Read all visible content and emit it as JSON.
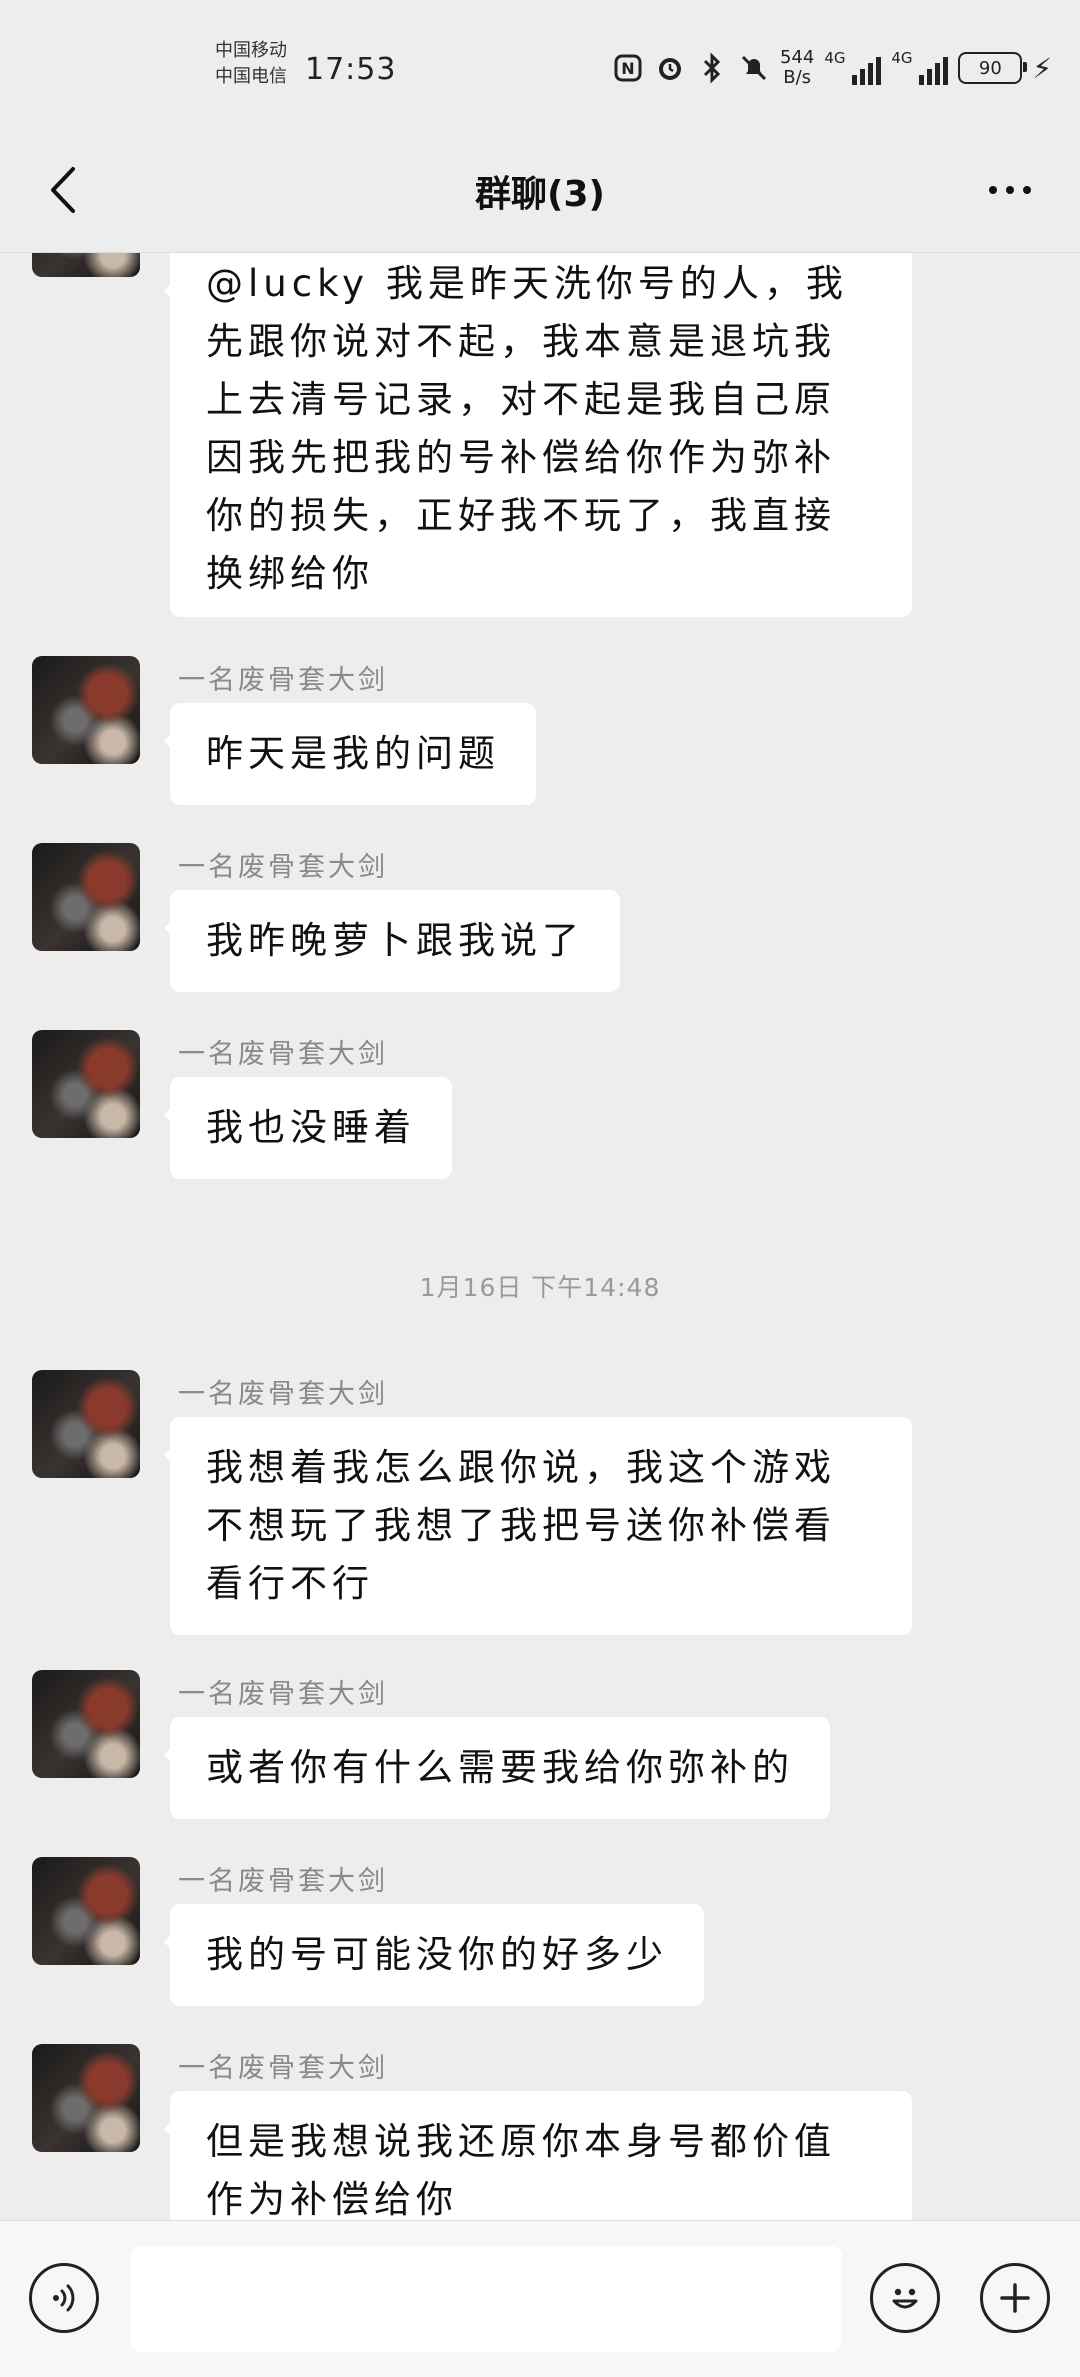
{
  "status_bar": {
    "carrier_1": "中国移动",
    "carrier_2": "中国电信",
    "time": "17:53",
    "net_speed_value": "544",
    "net_speed_unit": "B/s",
    "signal_1_label": "4G",
    "signal_2_label": "4G",
    "battery_level": "90"
  },
  "nav": {
    "title": "群聊(3)"
  },
  "messages": [
    {
      "sender": "",
      "text": "@lucky 我是昨天洗你号的人，我先跟你说对不起，我本意是退坑我上去清号记录，对不起是我自己原因我先把我的号补偿给你作为弥补你的损失，正好我不玩了，我直接换绑给你"
    },
    {
      "sender": "一名废骨套大剑",
      "text": "昨天是我的问题"
    },
    {
      "sender": "一名废骨套大剑",
      "text": "我昨晚萝卜跟我说了"
    },
    {
      "sender": "一名废骨套大剑",
      "text": "我也没睡着"
    },
    {
      "sender": "一名废骨套大剑",
      "text": "我想着我怎么跟你说，我这个游戏不想玩了我想了我把号送你补偿看看行不行"
    },
    {
      "sender": "一名废骨套大剑",
      "text": "或者你有什么需要我给你弥补的"
    },
    {
      "sender": "一名废骨套大剑",
      "text": "我的号可能没你的好多少"
    },
    {
      "sender": "一名废骨套大剑",
      "text": "但是我想说我还原你本身号都价值作为补偿给你"
    }
  ],
  "timestamp": "1月16日 下午14:48",
  "input": {
    "value": "",
    "placeholder": ""
  },
  "icons": {
    "back": "chevron-left-icon",
    "more": "more-dots-icon",
    "voice": "voice-icon",
    "emoji": "emoji-icon",
    "plus": "plus-icon"
  }
}
